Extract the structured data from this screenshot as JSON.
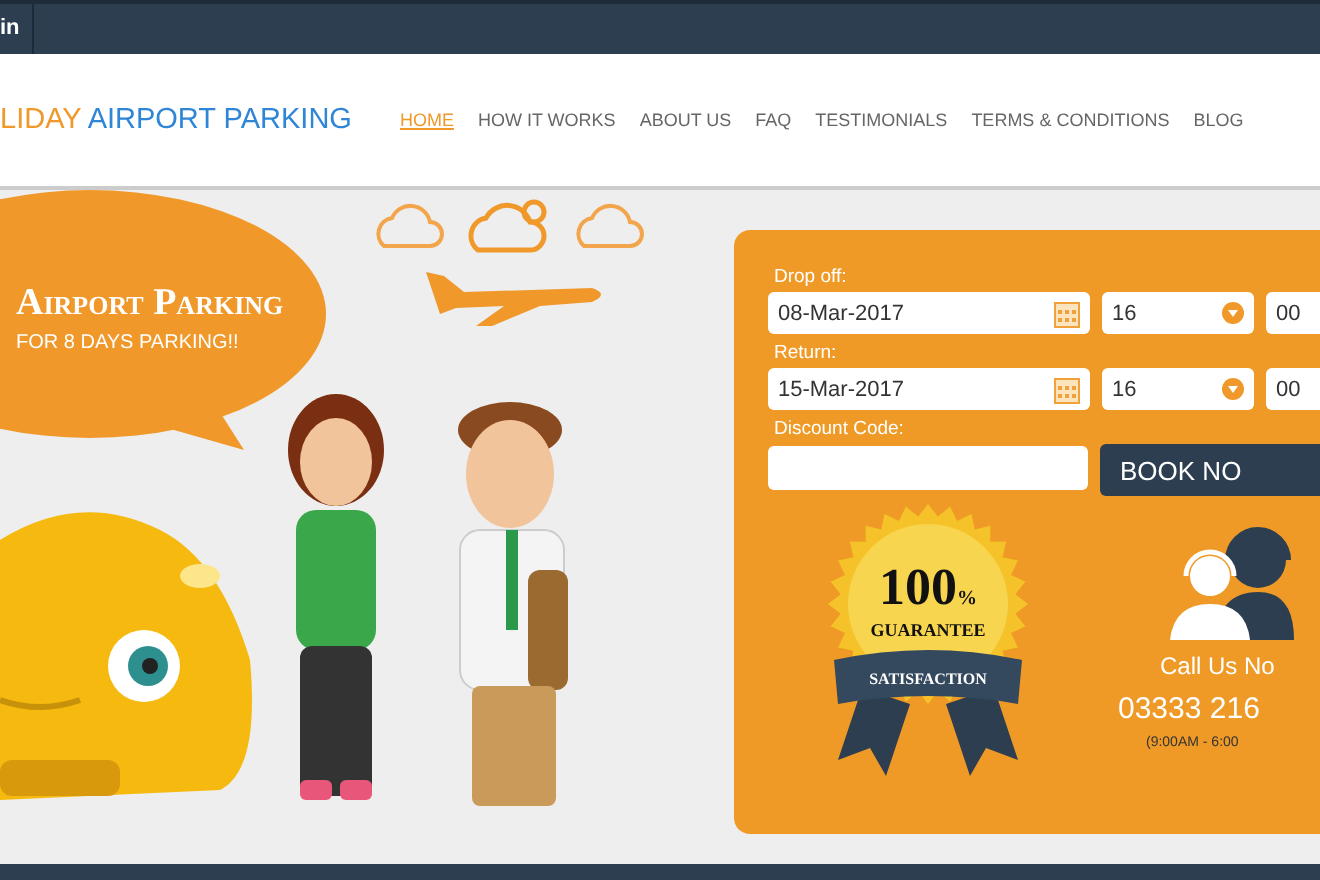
{
  "top_bar": {
    "text": "in"
  },
  "logo": {
    "part_1": "LIDAY",
    "part_2": "AIRPORT PARKING"
  },
  "nav": [
    {
      "label": "HOME",
      "selected": true
    },
    {
      "label": "HOW IT WORKS",
      "selected": false
    },
    {
      "label": "ABOUT US",
      "selected": false
    },
    {
      "label": "FAQ",
      "selected": false
    },
    {
      "label": "TESTIMONIALS",
      "selected": false
    },
    {
      "label": "TERMS & CONDITIONS",
      "selected": false
    },
    {
      "label": "BLOG",
      "selected": false
    }
  ],
  "promo": {
    "title": "Airport Parking",
    "subtitle": "FOR 8 DAYS PARKING!!"
  },
  "booking_form": {
    "fields": [
      {
        "label": "Drop off:",
        "date": "08-Mar-2017",
        "hour": "16",
        "minute": "00"
      },
      {
        "label": "Return:",
        "date": "15-Mar-2017",
        "hour": "16",
        "minute": "00"
      }
    ],
    "discount": {
      "label": "Discount Code:"
    },
    "book_button": "BOOK NO"
  },
  "guarantee_badge": {
    "number": "100",
    "percent": "%",
    "line_1": "GUARANTEE",
    "line_2": "SATISFACTION"
  },
  "contact": {
    "call": "Call Us No",
    "phone": "03333 216",
    "hours": "(9:00AM - 6:00"
  }
}
